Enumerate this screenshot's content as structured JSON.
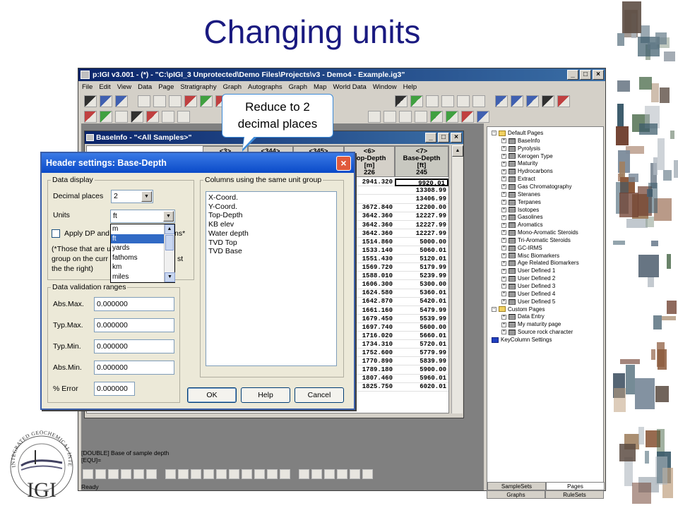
{
  "slide": {
    "title": "Changing units"
  },
  "logo": {
    "ring_text": "INTEGRATED GEOCHEMICAL INTERPRETATION",
    "abbr": "IGI"
  },
  "app": {
    "title": "p:IGI v3.001 - (*) - \"C:\\pIGI_3 Unprotected\\Demo Files\\Projects\\v3 - Demo4 - Example.ig3\"",
    "menu": [
      "File",
      "Edit",
      "View",
      "Data",
      "Page",
      "Stratigraphy",
      "Graph",
      "Autographs",
      "Graph",
      "Map",
      "World Data",
      "Window",
      "Help"
    ],
    "status_line1": "[DOUBLE] Base of sample depth",
    "status_line2": "[EQU]=",
    "ready": "Ready"
  },
  "callout": {
    "line1": "Reduce to 2",
    "line2": "decimal places"
  },
  "baseinfo": {
    "title": "BaseInfo - \"<All Samples>\"",
    "headers": [
      {
        "num": "<3>",
        "name": "",
        "unit": "",
        "count": ""
      },
      {
        "num": "<344>",
        "name": "",
        "unit": "",
        "count": ""
      },
      {
        "num": "<345>",
        "name": "",
        "unit": "",
        "count": ""
      },
      {
        "num": "<6>",
        "name": "Top-Depth",
        "unit": "[m]",
        "count": "226"
      },
      {
        "num": "<7>",
        "name": "Base-Depth",
        "unit": "[ft]",
        "count": "245"
      }
    ],
    "top_depth": [
      "2941.320",
      "",
      "",
      "3672.840",
      "3642.360",
      "3642.360",
      "3642.360",
      "1514.860",
      "1533.140",
      "1551.430",
      "1569.720",
      "1588.010",
      "1606.300",
      "1624.580",
      "1642.870",
      "1661.160",
      "1679.450",
      "1697.740",
      "1716.020",
      "1734.310",
      "1752.600",
      "1770.890",
      "1789.180",
      "1807.460",
      "1825.750"
    ],
    "base_depth": [
      "9920.01",
      "13308.99",
      "13406.99",
      "12200.00",
      "12227.99",
      "12227.99",
      "12227.99",
      "5000.00",
      "5060.01",
      "5120.01",
      "5179.99",
      "5239.99",
      "5300.00",
      "5360.01",
      "5420.01",
      "5479.99",
      "5539.99",
      "5600.00",
      "5660.01",
      "5720.01",
      "5779.99",
      "5839.99",
      "5900.00",
      "5960.01",
      "6020.01"
    ]
  },
  "dialog": {
    "title": "Header settings: Base-Depth",
    "data_display_legend": "Data display",
    "decimal_places_label": "Decimal places",
    "decimal_places_value": "2",
    "units_label": "Units",
    "units_value": "ft",
    "units_options": [
      "m",
      "ft",
      "yards",
      "fathoms",
      "km",
      "miles"
    ],
    "apply_dp_label_start": "Apply DP and",
    "apply_dp_label_end": "ns*",
    "note_line1": "(*Those that are u",
    "note_line2": "group on the curr",
    "note_line2_end": "st",
    "note_line3": "the the right)",
    "columns_legend": "Columns using the same unit group",
    "columns": [
      "X-Coord.",
      "Y-Coord.",
      "Top-Depth",
      "KB elev",
      "Water depth",
      "TVD Top",
      "TVD Base"
    ],
    "validation_legend": "Data validation ranges",
    "abs_max_label": "Abs.Max.",
    "abs_max_value": "0.000000",
    "typ_max_label": "Typ.Max.",
    "typ_max_value": "0.000000",
    "typ_min_label": "Typ.Min.",
    "typ_min_value": "0.000000",
    "abs_min_label": "Abs.Min.",
    "abs_min_value": "0.000000",
    "error_label": "% Error",
    "error_value": "0.000000",
    "ok_label": "OK",
    "help_label": "Help",
    "cancel_label": "Cancel"
  },
  "tree": {
    "items": [
      {
        "label": "Default Pages",
        "type": "folder",
        "indent": 0
      },
      {
        "label": "BaseInfo",
        "type": "page",
        "indent": 1
      },
      {
        "label": "Pyrolysis",
        "type": "page",
        "indent": 1
      },
      {
        "label": "Kerogen Type",
        "type": "page",
        "indent": 1
      },
      {
        "label": "Maturity",
        "type": "page",
        "indent": 1
      },
      {
        "label": "Hydrocarbons",
        "type": "page",
        "indent": 1
      },
      {
        "label": "Extract",
        "type": "page",
        "indent": 1
      },
      {
        "label": "Gas Chromatography",
        "type": "page",
        "indent": 1
      },
      {
        "label": "Steranes",
        "type": "page",
        "indent": 1
      },
      {
        "label": "Terpanes",
        "type": "page",
        "indent": 1
      },
      {
        "label": "Isotopes",
        "type": "page",
        "indent": 1
      },
      {
        "label": "Gasolines",
        "type": "page",
        "indent": 1
      },
      {
        "label": "Aromatics",
        "type": "page",
        "indent": 1
      },
      {
        "label": "Mono-Aromatic Steroids",
        "type": "page",
        "indent": 1
      },
      {
        "label": "Tri-Aromatic Steroids",
        "type": "page",
        "indent": 1
      },
      {
        "label": "GC-IRMS",
        "type": "page",
        "indent": 1
      },
      {
        "label": "Misc Biomarkers",
        "type": "page",
        "indent": 1
      },
      {
        "label": "Age Related Biomarkers",
        "type": "page",
        "indent": 1
      },
      {
        "label": "User Defined 1",
        "type": "page",
        "indent": 1
      },
      {
        "label": "User Defined 2",
        "type": "page",
        "indent": 1
      },
      {
        "label": "User Defined 3",
        "type": "page",
        "indent": 1
      },
      {
        "label": "User Defined 4",
        "type": "page",
        "indent": 1
      },
      {
        "label": "User Defined 5",
        "type": "page",
        "indent": 1
      },
      {
        "label": "Custom Pages",
        "type": "folder",
        "indent": 0
      },
      {
        "label": "Data Entry",
        "type": "page",
        "indent": 1
      },
      {
        "label": "My maturity page",
        "type": "page",
        "indent": 1
      },
      {
        "label": "Source rock character",
        "type": "page",
        "indent": 1
      },
      {
        "label": "KeyColumn Settings",
        "type": "key",
        "indent": 0
      }
    ],
    "tabs_row1": [
      "SampleSets",
      "Pages"
    ],
    "tabs_row2": [
      "Graphs",
      "RuleSets"
    ]
  },
  "colors": {
    "title": "#1a1a80",
    "xp_title": "#0a4ac8",
    "selection": "#316ac5"
  }
}
